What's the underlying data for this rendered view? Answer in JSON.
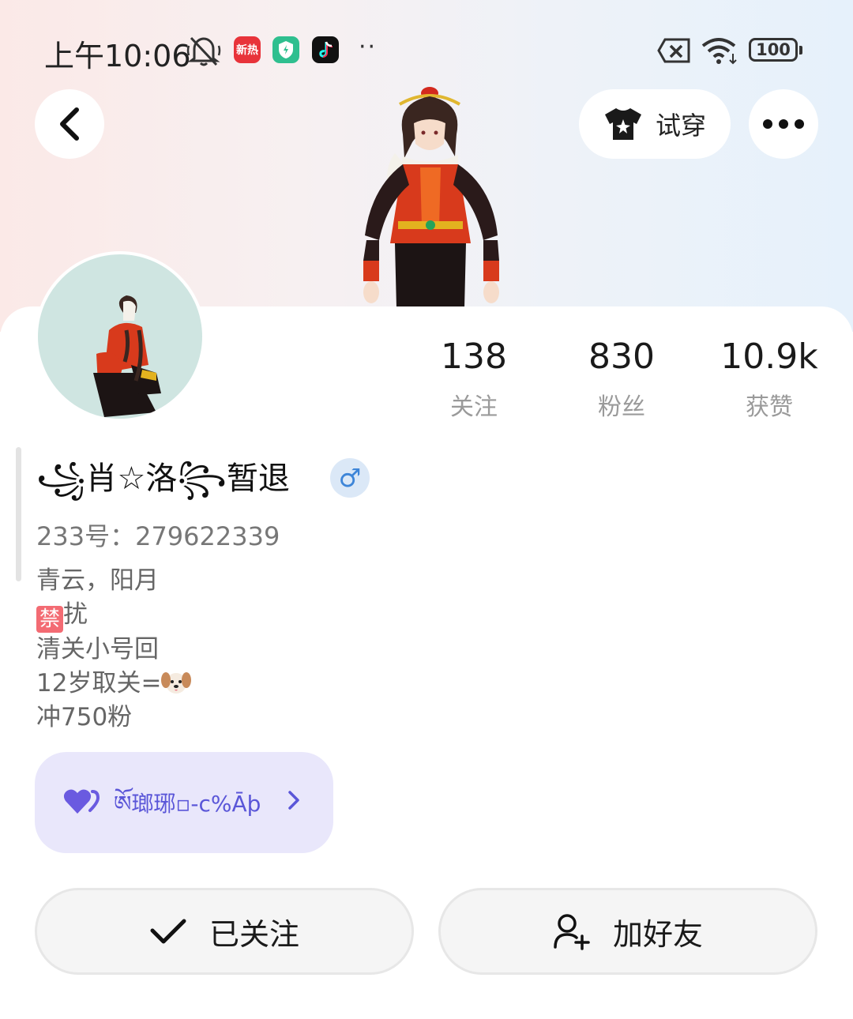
{
  "status_bar": {
    "time": "上午10:06",
    "app_badge_1": "新热",
    "overflow": "··",
    "battery": "100"
  },
  "nav": {
    "try_on_label": "试穿"
  },
  "profile": {
    "display_name": "꧁肖☆洛꧂暂退",
    "gender": "♂",
    "id_line": "233号：279622339",
    "stats": [
      {
        "value": "138",
        "label": "关注"
      },
      {
        "value": "830",
        "label": "粉丝"
      },
      {
        "value": "10.9k",
        "label": "获赞"
      }
    ],
    "bio": {
      "line1": "青云，阳月",
      "forbid_badge": "禁",
      "line2_rest": "扰",
      "line3": "清关小号回",
      "line4": "12岁取关=",
      "line5": "冲750粉"
    },
    "group_name": "ཨོ瑯琊▫-c%Āþ"
  },
  "actions": {
    "following_label": "已关注",
    "add_friend_label": "加好友"
  },
  "colors": {
    "group_bg": "#e9e7fb",
    "group_text": "#5a56d8",
    "gender_blue": "#3d85d8"
  }
}
